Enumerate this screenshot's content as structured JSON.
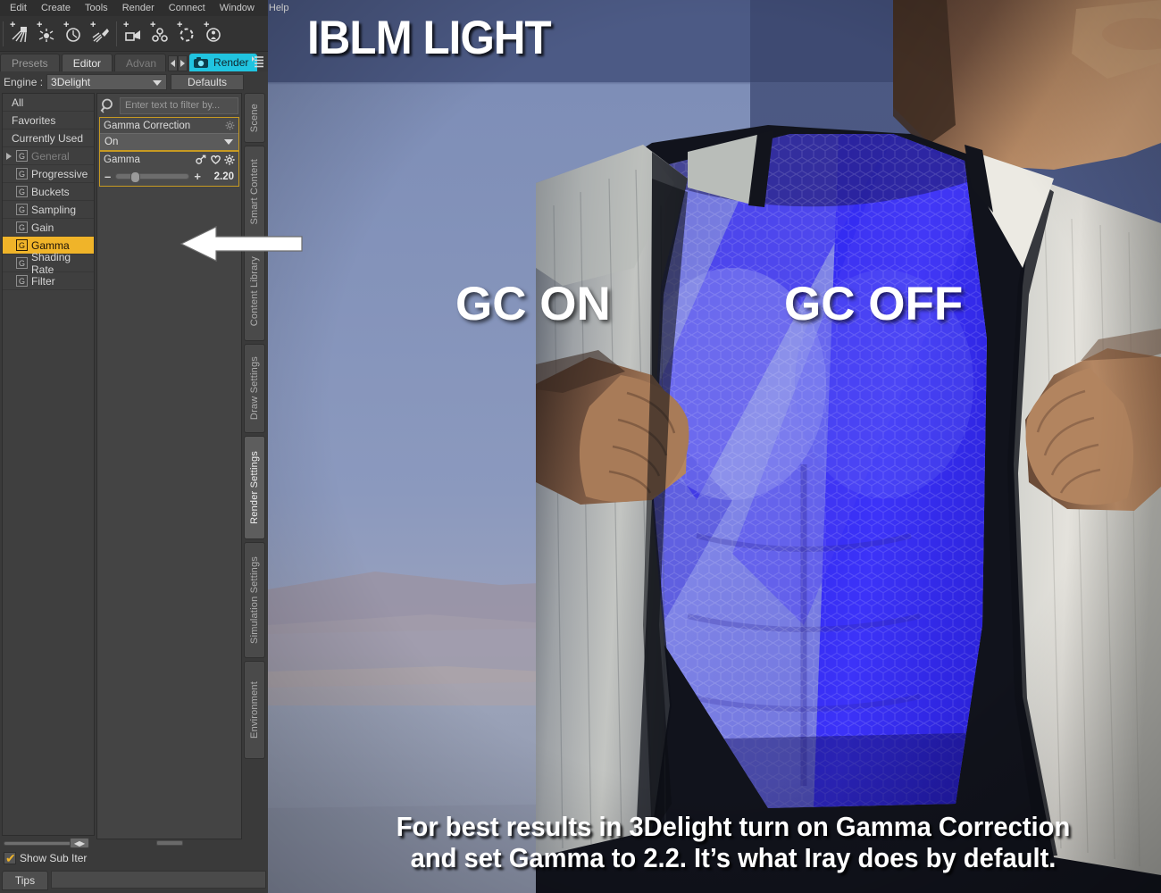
{
  "app": {
    "menu": [
      "Edit",
      "Create",
      "Tools",
      "Render",
      "Connect",
      "Window",
      "Help"
    ],
    "toolbar_icons": [
      "distant-light-add-icon",
      "point-light-add-icon",
      "spot-light-meter-add-icon",
      "spotlight-add-icon",
      "camera-add-icon",
      "primitive-sphere-add-icon",
      "null-node-add-icon",
      "figure-add-icon"
    ]
  },
  "pane": {
    "tabs": [
      {
        "label": "Presets",
        "active": false
      },
      {
        "label": "Editor",
        "active": true
      },
      {
        "label": "Advan",
        "active": false
      }
    ],
    "render_button": "Render",
    "engine_label": "Engine :",
    "engine_value": "3Delight",
    "defaults_button": "Defaults",
    "hamburger_icon": "pane-options-icon"
  },
  "sidebar": {
    "groups": [
      "All",
      "Favorites",
      "Currently Used"
    ],
    "items": [
      {
        "label": "General",
        "selected": false,
        "dim": true,
        "expandable": true
      },
      {
        "label": "Progressive",
        "selected": false,
        "dim": false,
        "expandable": false
      },
      {
        "label": "Buckets",
        "selected": false,
        "dim": false,
        "expandable": false
      },
      {
        "label": "Sampling",
        "selected": false,
        "dim": false,
        "expandable": false
      },
      {
        "label": "Gain",
        "selected": false,
        "dim": false,
        "expandable": false
      },
      {
        "label": "Gamma",
        "selected": true,
        "dim": false,
        "expandable": false
      },
      {
        "label": "Shading Rate",
        "selected": false,
        "dim": false,
        "expandable": false
      },
      {
        "label": "Filter",
        "selected": false,
        "dim": false,
        "expandable": false
      }
    ],
    "sub_iter_label": "Show Sub Iter",
    "sub_iter_checked": true
  },
  "properties": {
    "filter_placeholder": "Enter text to filter by...",
    "search_icon": "magnifier-icon",
    "gamma_correction": {
      "label": "Gamma Correction",
      "value": "On",
      "gear_icon": "gear-icon"
    },
    "gamma": {
      "label": "Gamma",
      "value": "2.20",
      "minus": "–",
      "plus": "+",
      "icons": [
        "link-icon",
        "heart-icon",
        "gear-icon"
      ],
      "slider_percent": 18
    }
  },
  "vertical_tabs": [
    {
      "label": "Scene",
      "active": false
    },
    {
      "label": "Smart Content",
      "active": false
    },
    {
      "label": "Content Library",
      "active": false
    },
    {
      "label": "Draw Settings",
      "active": false
    },
    {
      "label": "Render Settings",
      "active": true
    },
    {
      "label": "Simulation Settings",
      "active": false
    },
    {
      "label": "Environment",
      "active": false
    }
  ],
  "status": {
    "tips_tab": "Tips"
  },
  "overlay": {
    "title": "IBLM LIGHT",
    "gc_on": "GC ON",
    "gc_off": "GC OFF",
    "caption_line1": "For best results in 3Delight turn on Gamma Correction",
    "caption_line2": "and set Gamma to 2.2. It’s what Iray does by default.",
    "arrow_icon": "left-pointing-arrow-annotation"
  },
  "colors": {
    "accent_orange": "#f0b429",
    "render_cyan": "#20c4e0",
    "panel_bg": "#3a3a3a",
    "sky_blue": "#7f8fb8",
    "suit_blue_light": "#7b7fe0",
    "suit_blue_dark": "#3a32f5"
  }
}
